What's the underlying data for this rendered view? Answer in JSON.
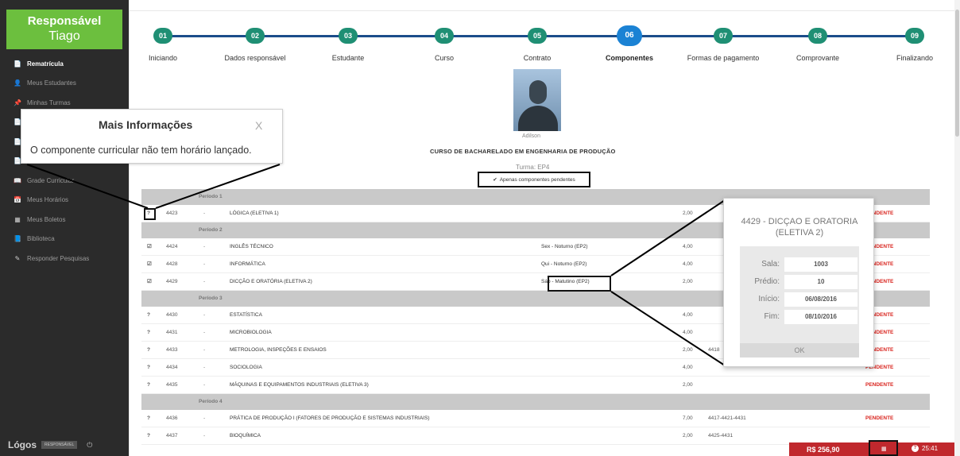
{
  "sidebar": {
    "brand_title": "Responsável",
    "brand_user": "Tiago",
    "items": [
      {
        "icon": "📄",
        "label": "Rematrícula"
      },
      {
        "icon": "👤",
        "label": "Meus Estudantes"
      },
      {
        "icon": "📌",
        "label": "Minhas Turmas"
      },
      {
        "icon": "📄",
        "label": ""
      },
      {
        "icon": "📄",
        "label": ""
      },
      {
        "icon": "📄",
        "label": ""
      },
      {
        "icon": "📖",
        "label": "Grade Curricular"
      },
      {
        "icon": "📅",
        "label": "Meus Horários"
      },
      {
        "icon": "▦",
        "label": "Meus Boletos"
      },
      {
        "icon": "📘",
        "label": "Biblioteca"
      },
      {
        "icon": "✎",
        "label": "Responder Pesquisas"
      }
    ],
    "footer_logo": "Lógos",
    "footer_role": "RESPONSÁVEL",
    "footer_power": "⏻"
  },
  "steps": [
    {
      "num": "01",
      "label": "Iniciando"
    },
    {
      "num": "02",
      "label": "Dados responsável"
    },
    {
      "num": "03",
      "label": "Estudante"
    },
    {
      "num": "04",
      "label": "Curso"
    },
    {
      "num": "05",
      "label": "Contrato"
    },
    {
      "num": "06",
      "label": "Componentes"
    },
    {
      "num": "07",
      "label": "Formas de pagamento"
    },
    {
      "num": "08",
      "label": "Comprovante"
    },
    {
      "num": "09",
      "label": "Finalizando"
    }
  ],
  "student": {
    "name": "Adilson",
    "course": "CURSO DE BACHARELADO EM ENGENHARIA DE PRODUÇÃO",
    "turma": "Turma: EP4",
    "filter_check": "✔",
    "filter_label": "Apenas componentes pendentes"
  },
  "table": {
    "rows": [
      {
        "type": "period",
        "label": "Período 1"
      },
      {
        "chk": "?",
        "code": "4423",
        "dash": "-",
        "name": "LÓGICA (ELETIVA 1)",
        "sched": "",
        "cred": "2,00",
        "pre": "",
        "status": "PENDENTE"
      },
      {
        "type": "period",
        "label": "Período 2"
      },
      {
        "chk": "☑",
        "code": "4424",
        "dash": "-",
        "name": "INGLÊS TÉCNICO",
        "sched": "Sex - Noturno (EP2)",
        "cred": "4,00",
        "pre": "",
        "status": "PENDENTE"
      },
      {
        "chk": "☑",
        "code": "4428",
        "dash": "-",
        "name": "INFORMÁTICA",
        "sched": "Qui - Noturno (EP2)",
        "cred": "4,00",
        "pre": "",
        "status": "PENDENTE"
      },
      {
        "chk": "☑",
        "code": "4429",
        "dash": "-",
        "name": "DICÇÃO E ORATÓRIA (ELETIVA 2)",
        "sched": "Sáb - Matutino (EP2)",
        "cred": "2,00",
        "pre": "",
        "status": "PENDENTE"
      },
      {
        "type": "period",
        "label": "Período 3"
      },
      {
        "chk": "?",
        "code": "4430",
        "dash": "-",
        "name": "ESTATÍSTICA",
        "sched": "",
        "cred": "4,00",
        "pre": "",
        "status": "PENDENTE"
      },
      {
        "chk": "?",
        "code": "4431",
        "dash": "-",
        "name": "MICROBIOLOGIA",
        "sched": "",
        "cred": "4,00",
        "pre": "",
        "status": "PENDENTE"
      },
      {
        "chk": "?",
        "code": "4433",
        "dash": "-",
        "name": "METROLOGIA, INSPEÇÕES E ENSAIOS",
        "sched": "",
        "cred": "2,00",
        "pre": "4418",
        "status": "PENDENTE"
      },
      {
        "chk": "?",
        "code": "4434",
        "dash": "-",
        "name": "SOCIOLOGIA",
        "sched": "",
        "cred": "4,00",
        "pre": "",
        "status": "PENDENTE"
      },
      {
        "chk": "?",
        "code": "4435",
        "dash": "-",
        "name": "MÁQUINAS E EQUIPAMENTOS INDUSTRIAIS (ELETIVA 3)",
        "sched": "",
        "cred": "2,00",
        "pre": "",
        "status": "PENDENTE"
      },
      {
        "type": "period",
        "label": "Período 4"
      },
      {
        "chk": "?",
        "code": "4436",
        "dash": "-",
        "name": "PRÁTICA DE PRODUÇÃO I (FATORES DE PRODUÇÃO E SISTEMAS INDUSTRIAIS)",
        "sched": "",
        "cred": "7,00",
        "pre": "4417-4421-4431",
        "status": "PENDENTE"
      },
      {
        "chk": "?",
        "code": "4437",
        "dash": "-",
        "name": "BIOQUÍMICA",
        "sched": "",
        "cred": "2,00",
        "pre": "4425-4431",
        "status": ""
      }
    ]
  },
  "info_popup": {
    "title": "Mais Informações",
    "close": "X",
    "message": "O componente curricular não tem horário lançado."
  },
  "detail_popup": {
    "title": "4429  -  DICÇAO E ORATORIA (ELETIVA 2)",
    "fields": [
      {
        "label": "Sala:",
        "value": "1003"
      },
      {
        "label": "Prédio:",
        "value": "10"
      },
      {
        "label": "Início:",
        "value": "06/08/2016"
      },
      {
        "label": "Fim:",
        "value": "08/10/2016"
      }
    ],
    "ok_label": "OK"
  },
  "bottom_bar": {
    "price": "R$ 256,90",
    "calendar_icon": "▦",
    "help_icon": "?",
    "timer": "25:41"
  }
}
